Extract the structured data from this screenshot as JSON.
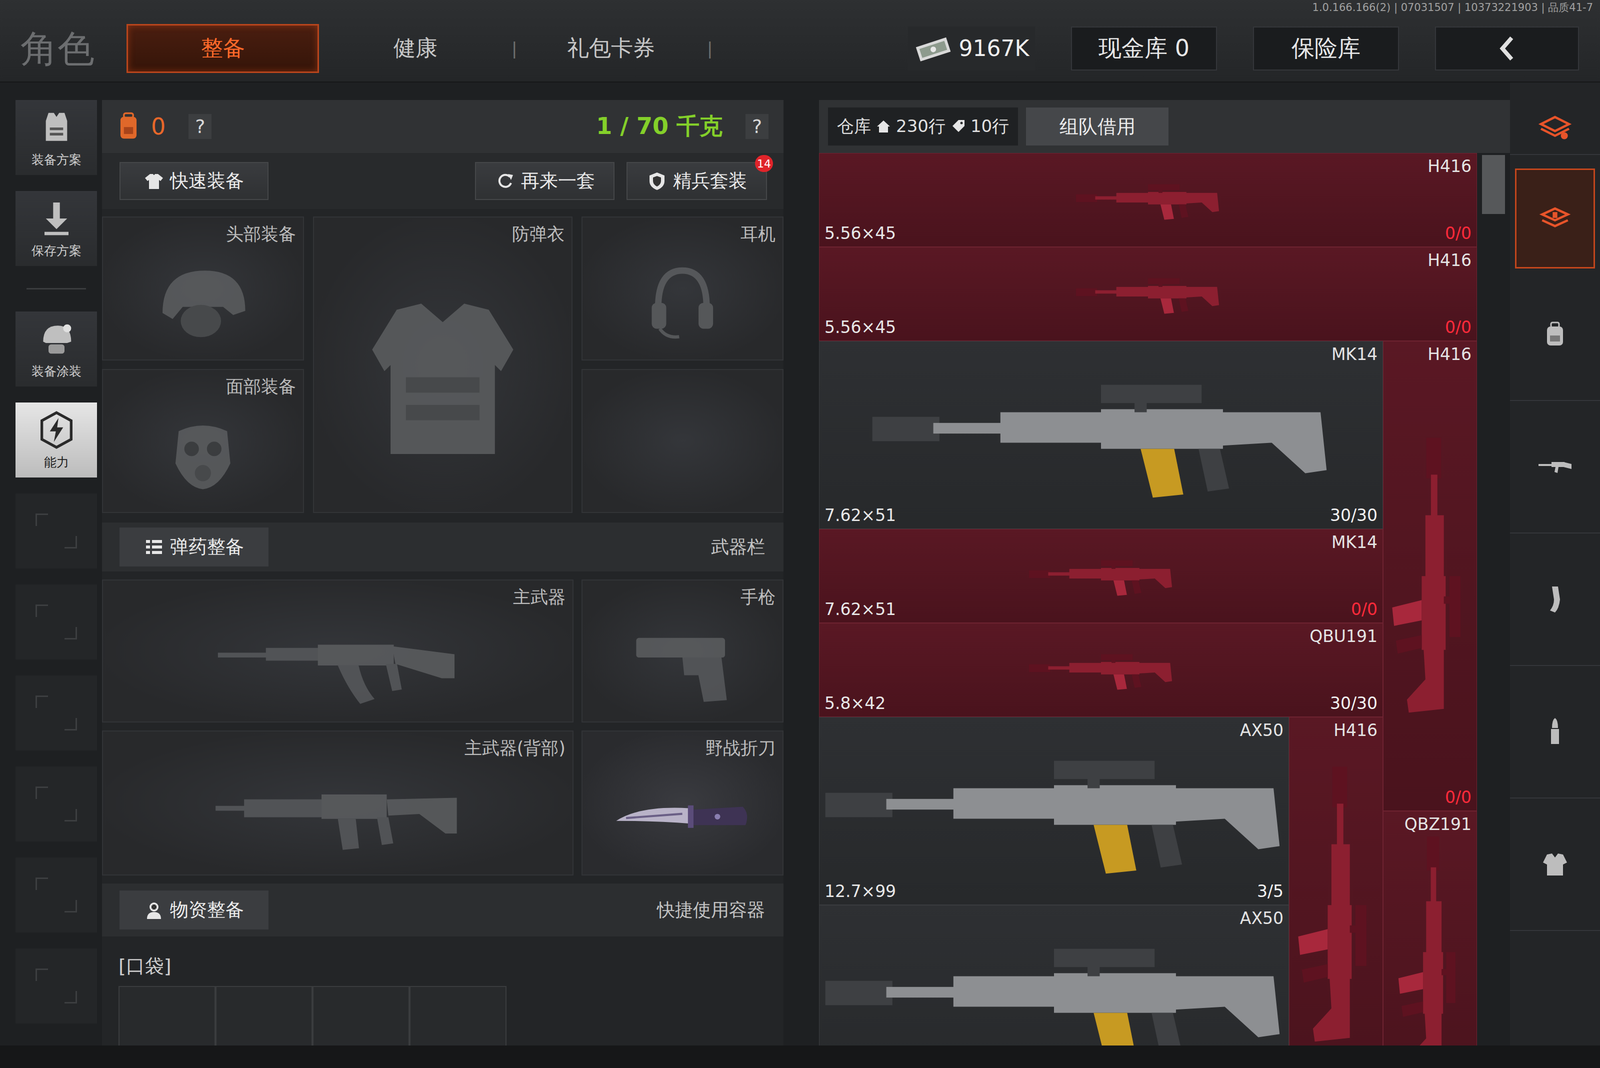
{
  "header": {
    "version": "1.0.166.166(2) | 07031507 | 10373221903 | 品质41-7",
    "title": "角色",
    "separator": "|",
    "tabs": [
      {
        "label": "整备",
        "selected": true
      },
      {
        "label": "健康",
        "selected": false
      },
      {
        "label": "礼包卡券",
        "selected": false
      }
    ],
    "cash": "9167K",
    "vault_buttons": [
      "现金库 0",
      "保险库"
    ]
  },
  "sidebar": {
    "items": [
      {
        "label": "装备方案",
        "kind": "plan",
        "selected": false
      },
      {
        "label": "保存方案",
        "kind": "save",
        "selected": false
      },
      {
        "label": "装备涂装",
        "kind": "paint",
        "selected": false
      },
      {
        "label": "能力",
        "kind": "ability",
        "selected": true
      }
    ],
    "empty_slots": 6
  },
  "loadout": {
    "backpack_count": "0",
    "help": "?",
    "weight": "1 / 70 千克",
    "buttons": [
      {
        "label": "快速装备",
        "kind": "shirt"
      },
      {
        "label": "再来一套",
        "kind": "refresh"
      },
      {
        "label": "精兵套装",
        "kind": "shield",
        "badge": "14"
      }
    ],
    "gear_slots": [
      {
        "label": "头部装备",
        "kind": "helmet"
      },
      {
        "label": "防弹衣",
        "kind": "vest"
      },
      {
        "label": "耳机",
        "kind": "headset"
      },
      {
        "label": "面部装备",
        "kind": "mask"
      },
      {
        "kind": "empty"
      }
    ],
    "ammo_section": {
      "title": "弹药整备",
      "right": "武器栏"
    },
    "weapon_slots": [
      {
        "label": "主武器",
        "kind": "rifle",
        "equipped": false
      },
      {
        "label": "手枪",
        "kind": "pistol",
        "equipped": false
      },
      {
        "label": "主武器(背部)",
        "kind": "carbine",
        "equipped": false
      },
      {
        "label": "野战折刀",
        "kind": "knife",
        "equipped": true
      }
    ],
    "supply_section": {
      "title": "物资整备",
      "right": "快捷使用容器"
    },
    "pocket_label": "[口袋]",
    "pocket_slots": 4
  },
  "warehouse": {
    "label": "仓库",
    "home_rows": "230行",
    "extra_rows": "10行",
    "borrow": "组队借用",
    "items": [
      {
        "name": "H416",
        "caliber": "5.56×45",
        "ammo": "0/0",
        "ammo_empty": true,
        "highlighted": true
      },
      {
        "name": "H416",
        "caliber": "5.56×45",
        "ammo": "0/0",
        "ammo_empty": true,
        "highlighted": true
      },
      {
        "name": "MK14",
        "caliber": "7.62×51",
        "ammo": "30/30",
        "ammo_empty": false,
        "highlighted": false
      },
      {
        "name": "H416",
        "ammo": "0/0",
        "ammo_empty": true,
        "highlighted": true
      },
      {
        "name": "MK14",
        "caliber": "7.62×51",
        "ammo": "0/0",
        "ammo_empty": true,
        "highlighted": true
      },
      {
        "name": "QBU191",
        "caliber": "5.8×42",
        "ammo": "30/30",
        "ammo_empty": false,
        "highlighted": true
      },
      {
        "name": "AX50",
        "caliber": "12.7×99",
        "ammo": "3/5",
        "ammo_empty": false,
        "highlighted": false
      },
      {
        "name": "H416",
        "highlighted": true
      },
      {
        "name": "QBZ191",
        "highlighted": true
      },
      {
        "name": "AX50",
        "highlighted": false
      }
    ]
  },
  "category_tabs": [
    {
      "kind": "shop",
      "selected": false
    },
    {
      "kind": "storage",
      "selected": true
    },
    {
      "kind": "backpack",
      "selected": false
    },
    {
      "kind": "rifle",
      "selected": false
    },
    {
      "kind": "magazine",
      "selected": false
    },
    {
      "kind": "ammo",
      "selected": false
    },
    {
      "kind": "vest",
      "selected": false
    }
  ]
}
